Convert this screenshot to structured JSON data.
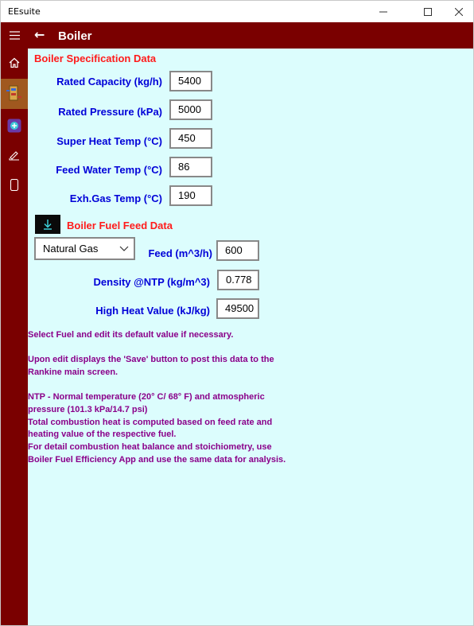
{
  "window": {
    "title": "EEsuite",
    "minimize": "—",
    "maximize": "☐",
    "close": "✕"
  },
  "header": {
    "back": "←",
    "title": "Boiler"
  },
  "sidebar": {
    "items": [
      {
        "name": "home-icon"
      },
      {
        "name": "boiler-icon"
      },
      {
        "name": "calculator-icon"
      },
      {
        "name": "pencil-icon"
      },
      {
        "name": "phone-icon"
      }
    ]
  },
  "spec": {
    "title": "Boiler Specification Data",
    "rows": [
      {
        "label": "Rated Capacity (kg/h)",
        "value": "5400"
      },
      {
        "label": "Rated Pressure (kPa)",
        "value": "5000"
      },
      {
        "label": "Super Heat Temp (°C)",
        "value": "450"
      },
      {
        "label": "Feed Water Temp (°C)",
        "value": "86"
      },
      {
        "label": "Exh.Gas Temp (°C)",
        "value": "190"
      }
    ]
  },
  "fuel": {
    "title": "Boiler Fuel Feed Data",
    "download_glyph": "↓",
    "selected": "Natural Gas",
    "rows": [
      {
        "label": "Feed (m^3/h)",
        "value": "600"
      },
      {
        "label": "Density @NTP (kg/m^3)",
        "value": "0.778"
      },
      {
        "label": "High Heat Value (kJ/kg)",
        "value": "49500"
      }
    ]
  },
  "notes": {
    "p1": "Select Fuel and edit its default value if necessary.",
    "p2": "Upon edit displays the 'Save' button to post this data to the Rankine main screen.",
    "p3": "NTP - Normal temperature (20° C/ 68° F) and atmospheric pressure (101.3 kPa/14.7 psi)\nTotal combustion heat is computed based on feed rate and heating value of the respective fuel.\nFor detail combustion heat balance and stoichiometry, use Boiler Fuel Efficiency App and use the same data for analysis."
  }
}
